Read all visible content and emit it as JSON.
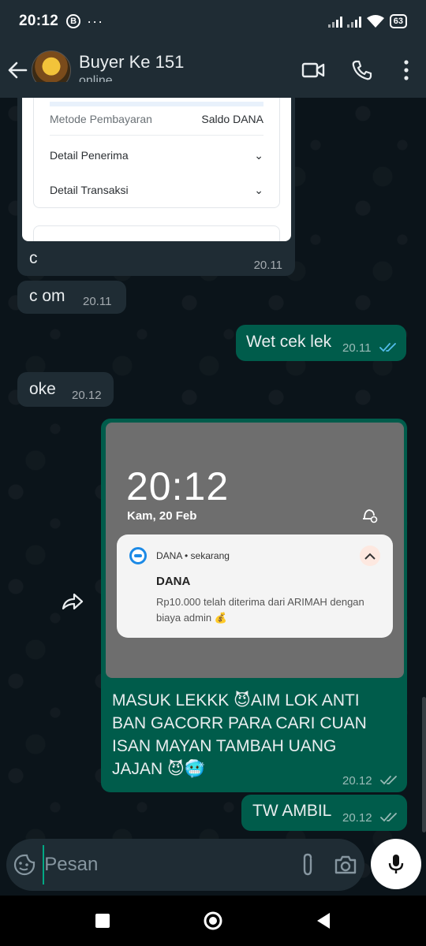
{
  "status_bar": {
    "time": "20:12",
    "b_badge": "B",
    "dots": "···",
    "battery": "63"
  },
  "header": {
    "contact_name": "Buyer Ke 151",
    "contact_status": "online"
  },
  "receipt": {
    "payment_method_label": "Metode Pembayaran",
    "payment_method_value": "Saldo DANA",
    "recipient_detail": "Detail Penerima",
    "transaction_detail": "Detail Transaksi"
  },
  "messages": [
    {
      "text": "c",
      "time": "20.11",
      "direction": "in"
    },
    {
      "text": "c om",
      "time": "20.11",
      "direction": "in"
    },
    {
      "text": "Wet cek lek",
      "time": "20.11",
      "direction": "out",
      "ticks": "read"
    },
    {
      "text": "oke",
      "time": "20.12",
      "direction": "in"
    },
    {
      "text": "MASUK LEKKK 😈AIM LOK ANTI BAN GACORR PARA CARI CUAN ISAN MAYAN TAMBAH UANG JAJAN 😈🥶",
      "time": "20.12",
      "direction": "out",
      "ticks": "delivered"
    },
    {
      "text": "TW AMBIL",
      "time": "20.12",
      "direction": "out",
      "ticks": "delivered"
    }
  ],
  "notification_screenshot": {
    "lock_time": "20:12",
    "lock_date": "Kam, 20 Feb",
    "app_line": "DANA • sekarang",
    "title": "DANA",
    "body": "Rp10.000 telah diterima dari ARIMAH dengan biaya admin 💰"
  },
  "composer": {
    "placeholder": "Pesan"
  },
  "colors": {
    "header_bg": "#1f2c34",
    "incoming_bubble": "#1f2c34",
    "outgoing_bubble": "#005c4b",
    "read_tick": "#53bdeb",
    "chat_bg": "#0b141a"
  }
}
